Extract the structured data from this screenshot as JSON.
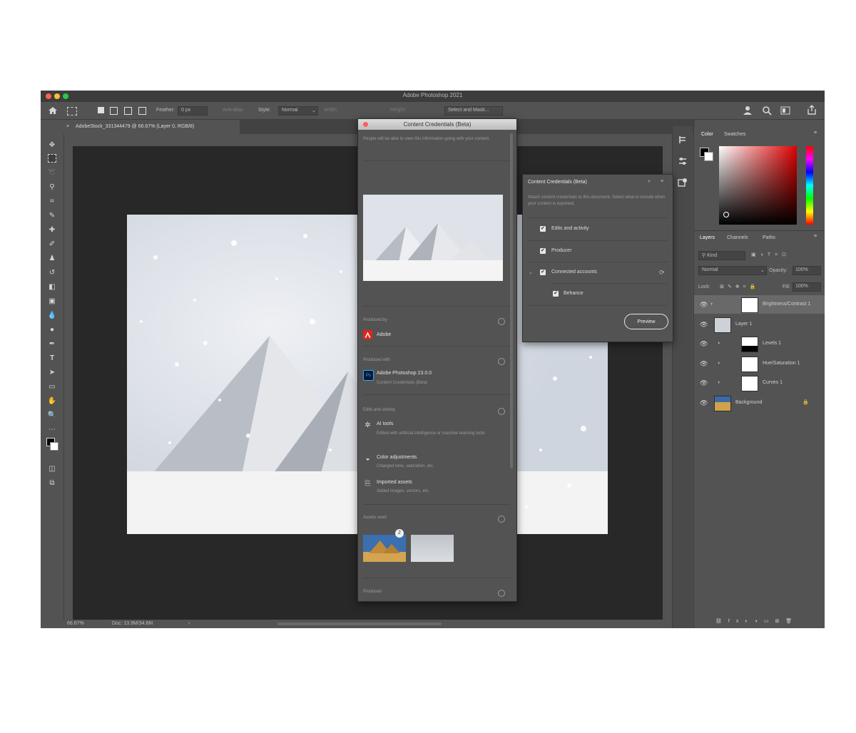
{
  "window": {
    "title": "Adobe Photoshop 2021",
    "traffic_colors": [
      "#ff5f57",
      "#febc2e",
      "#28c840"
    ]
  },
  "options_bar": {
    "feather_label": "Feather:",
    "feather_value": "0 px",
    "antialias": "Anti-alias",
    "style_label": "Style:",
    "style_value": "Normal",
    "width_label": "Width:",
    "height_label": "Height:",
    "select_mask": "Select and Mask..."
  },
  "document_tab": {
    "label": "AdobeStock_331344479 @ 66.67% (Layer 0, RGB/8)"
  },
  "status_bar": {
    "zoom": "66.67%",
    "doc_info": "Doc: 13.9M/34.6M"
  },
  "cc_panel": {
    "title": "Content Credentials (Beta)",
    "intro": "People will be able to view this information going with your content.",
    "sections": {
      "produced_by": "Produced by",
      "app_used": "Produced with",
      "edits": "Edits and activity",
      "assets": "Assets used",
      "footer": "Produced"
    },
    "producer": "Adobe",
    "app_name": "Adobe Photoshop 23.0.0",
    "app_sub": "Content Credentials (Beta)",
    "edit_items": [
      {
        "title": "AI tools",
        "sub": "Edited with artificial intelligence or machine learning tools"
      },
      {
        "title": "Color adjustments",
        "sub": "Changed tone, saturation, etc."
      },
      {
        "title": "Imported assets",
        "sub": "Added images, vectors, etc."
      }
    ],
    "asset_badge": "2"
  },
  "flyout": {
    "title": "Content Credentials (Beta)",
    "desc": "Attach content credentials to this document. Select what to include when your content is exported.",
    "options": [
      {
        "label": "Edits and activity",
        "checked": "✔"
      },
      {
        "label": "Producer",
        "checked": "✔"
      },
      {
        "label": "Connected accounts",
        "checked": "✔"
      },
      {
        "label": "Behance",
        "checked": "✔"
      }
    ],
    "preview_button": "Preview"
  },
  "color_panel": {
    "tabs": [
      "Color",
      "Swatches"
    ]
  },
  "layers_panel": {
    "tabs": [
      "Layers",
      "Channels",
      "Paths"
    ],
    "kind": "Kind",
    "blend_mode": "Normal",
    "opacity_label": "Opacity:",
    "opacity_value": "100%",
    "lock_label": "Lock:",
    "fill_label": "Fill:",
    "fill_value": "100%",
    "layers": [
      {
        "name": "Brightness/Contrast 1"
      },
      {
        "name": "Layer 1"
      },
      {
        "name": "Levels 1"
      },
      {
        "name": "Hue/Saturation 1"
      },
      {
        "name": "Curves 1"
      },
      {
        "name": "Background"
      }
    ]
  }
}
